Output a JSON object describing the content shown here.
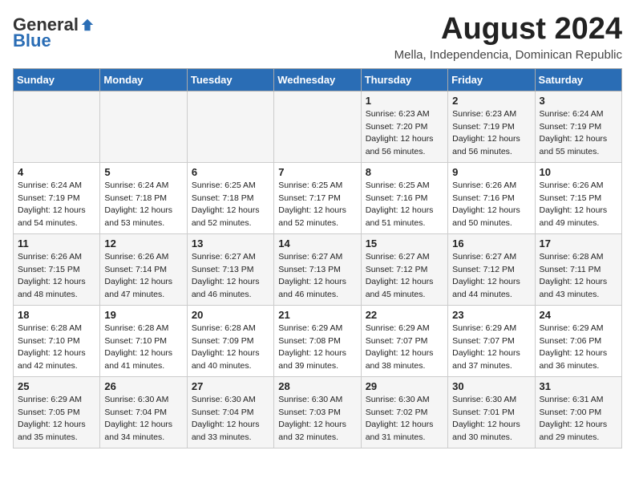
{
  "header": {
    "logo_general": "General",
    "logo_blue": "Blue",
    "month_title": "August 2024",
    "subtitle": "Mella, Independencia, Dominican Republic"
  },
  "weekdays": [
    "Sunday",
    "Monday",
    "Tuesday",
    "Wednesday",
    "Thursday",
    "Friday",
    "Saturday"
  ],
  "weeks": [
    [
      {
        "day": "",
        "info": ""
      },
      {
        "day": "",
        "info": ""
      },
      {
        "day": "",
        "info": ""
      },
      {
        "day": "",
        "info": ""
      },
      {
        "day": "1",
        "info": "Sunrise: 6:23 AM\nSunset: 7:20 PM\nDaylight: 12 hours\nand 56 minutes."
      },
      {
        "day": "2",
        "info": "Sunrise: 6:23 AM\nSunset: 7:19 PM\nDaylight: 12 hours\nand 56 minutes."
      },
      {
        "day": "3",
        "info": "Sunrise: 6:24 AM\nSunset: 7:19 PM\nDaylight: 12 hours\nand 55 minutes."
      }
    ],
    [
      {
        "day": "4",
        "info": "Sunrise: 6:24 AM\nSunset: 7:19 PM\nDaylight: 12 hours\nand 54 minutes."
      },
      {
        "day": "5",
        "info": "Sunrise: 6:24 AM\nSunset: 7:18 PM\nDaylight: 12 hours\nand 53 minutes."
      },
      {
        "day": "6",
        "info": "Sunrise: 6:25 AM\nSunset: 7:18 PM\nDaylight: 12 hours\nand 52 minutes."
      },
      {
        "day": "7",
        "info": "Sunrise: 6:25 AM\nSunset: 7:17 PM\nDaylight: 12 hours\nand 52 minutes."
      },
      {
        "day": "8",
        "info": "Sunrise: 6:25 AM\nSunset: 7:16 PM\nDaylight: 12 hours\nand 51 minutes."
      },
      {
        "day": "9",
        "info": "Sunrise: 6:26 AM\nSunset: 7:16 PM\nDaylight: 12 hours\nand 50 minutes."
      },
      {
        "day": "10",
        "info": "Sunrise: 6:26 AM\nSunset: 7:15 PM\nDaylight: 12 hours\nand 49 minutes."
      }
    ],
    [
      {
        "day": "11",
        "info": "Sunrise: 6:26 AM\nSunset: 7:15 PM\nDaylight: 12 hours\nand 48 minutes."
      },
      {
        "day": "12",
        "info": "Sunrise: 6:26 AM\nSunset: 7:14 PM\nDaylight: 12 hours\nand 47 minutes."
      },
      {
        "day": "13",
        "info": "Sunrise: 6:27 AM\nSunset: 7:13 PM\nDaylight: 12 hours\nand 46 minutes."
      },
      {
        "day": "14",
        "info": "Sunrise: 6:27 AM\nSunset: 7:13 PM\nDaylight: 12 hours\nand 46 minutes."
      },
      {
        "day": "15",
        "info": "Sunrise: 6:27 AM\nSunset: 7:12 PM\nDaylight: 12 hours\nand 45 minutes."
      },
      {
        "day": "16",
        "info": "Sunrise: 6:27 AM\nSunset: 7:12 PM\nDaylight: 12 hours\nand 44 minutes."
      },
      {
        "day": "17",
        "info": "Sunrise: 6:28 AM\nSunset: 7:11 PM\nDaylight: 12 hours\nand 43 minutes."
      }
    ],
    [
      {
        "day": "18",
        "info": "Sunrise: 6:28 AM\nSunset: 7:10 PM\nDaylight: 12 hours\nand 42 minutes."
      },
      {
        "day": "19",
        "info": "Sunrise: 6:28 AM\nSunset: 7:10 PM\nDaylight: 12 hours\nand 41 minutes."
      },
      {
        "day": "20",
        "info": "Sunrise: 6:28 AM\nSunset: 7:09 PM\nDaylight: 12 hours\nand 40 minutes."
      },
      {
        "day": "21",
        "info": "Sunrise: 6:29 AM\nSunset: 7:08 PM\nDaylight: 12 hours\nand 39 minutes."
      },
      {
        "day": "22",
        "info": "Sunrise: 6:29 AM\nSunset: 7:07 PM\nDaylight: 12 hours\nand 38 minutes."
      },
      {
        "day": "23",
        "info": "Sunrise: 6:29 AM\nSunset: 7:07 PM\nDaylight: 12 hours\nand 37 minutes."
      },
      {
        "day": "24",
        "info": "Sunrise: 6:29 AM\nSunset: 7:06 PM\nDaylight: 12 hours\nand 36 minutes."
      }
    ],
    [
      {
        "day": "25",
        "info": "Sunrise: 6:29 AM\nSunset: 7:05 PM\nDaylight: 12 hours\nand 35 minutes."
      },
      {
        "day": "26",
        "info": "Sunrise: 6:30 AM\nSunset: 7:04 PM\nDaylight: 12 hours\nand 34 minutes."
      },
      {
        "day": "27",
        "info": "Sunrise: 6:30 AM\nSunset: 7:04 PM\nDaylight: 12 hours\nand 33 minutes."
      },
      {
        "day": "28",
        "info": "Sunrise: 6:30 AM\nSunset: 7:03 PM\nDaylight: 12 hours\nand 32 minutes."
      },
      {
        "day": "29",
        "info": "Sunrise: 6:30 AM\nSunset: 7:02 PM\nDaylight: 12 hours\nand 31 minutes."
      },
      {
        "day": "30",
        "info": "Sunrise: 6:30 AM\nSunset: 7:01 PM\nDaylight: 12 hours\nand 30 minutes."
      },
      {
        "day": "31",
        "info": "Sunrise: 6:31 AM\nSunset: 7:00 PM\nDaylight: 12 hours\nand 29 minutes."
      }
    ]
  ]
}
